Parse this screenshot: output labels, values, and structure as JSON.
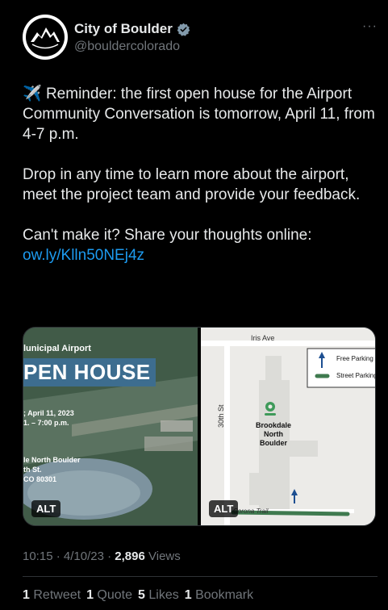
{
  "author": {
    "display_name": "City of Boulder",
    "handle": "@bouldercolorado",
    "verified_color": "#829aab",
    "avatar_text": "CITY OF BOULDER"
  },
  "more_label": "···",
  "tweet": {
    "emoji": "✈️",
    "para1": "Reminder: the first open house for the Airport Community Conversation is tomorrow, April 11, from 4-7 p.m.",
    "para2": "Drop in any time to learn more about the airport, meet the project team and provide your feedback.",
    "para3": "Can't make it? Share your thoughts online:",
    "link": "ow.ly/Klln50NEj4z"
  },
  "media": {
    "left": {
      "subtitle": "lunicipal Airport",
      "title": "PEN HOUSE",
      "date": "; April 11, 2023",
      "time": "1. – 7:00 p.m.",
      "venue": "le North Boulder",
      "street": "th St.",
      "city": "CO 80301",
      "alt": "ALT"
    },
    "right": {
      "street_top": "Iris Ave",
      "street_side": "30th St",
      "place_line1": "Brookdale",
      "place_line2": "North Boulder",
      "trail": "Corona Trail",
      "legend1": "Free Parking",
      "legend2": "Street Parking",
      "alt": "ALT"
    }
  },
  "meta": {
    "time": "10:15",
    "date": "4/10/23",
    "views_count": "2,896",
    "views_label": "Views",
    "sep": "·"
  },
  "stats": {
    "retweets_count": "1",
    "retweets_label": "Retweet",
    "quotes_count": "1",
    "quotes_label": "Quote",
    "likes_count": "5",
    "likes_label": "Likes",
    "bookmarks_count": "1",
    "bookmarks_label": "Bookmark"
  }
}
